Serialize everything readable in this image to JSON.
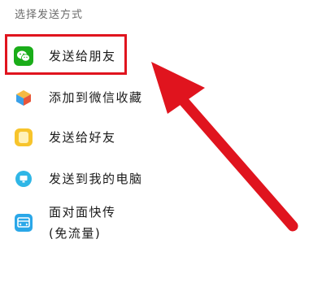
{
  "header": {
    "title": "选择发送方式"
  },
  "options": [
    {
      "label": "发送给朋友",
      "icon": "wechat-icon"
    },
    {
      "label": "添加到微信收藏",
      "icon": "favorites-cube-icon"
    },
    {
      "label": "发送给好友",
      "icon": "note-icon"
    },
    {
      "label": "发送到我的电脑",
      "icon": "computer-icon"
    },
    {
      "label_line1": "面对面快传",
      "label_line2": "(免流量)",
      "icon": "face-to-face-transfer-icon"
    }
  ],
  "colors": {
    "highlight": "#e0141e",
    "arrow": "#e0141e",
    "wechat_green": "#1aad19"
  }
}
